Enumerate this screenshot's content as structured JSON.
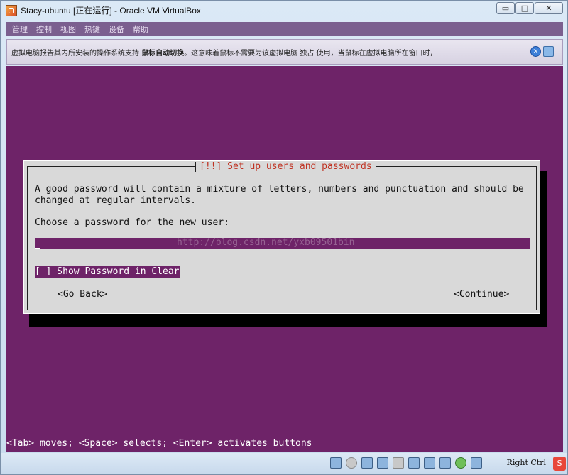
{
  "window": {
    "title": "Stacy-ubuntu [正在运行] - Oracle VM VirtualBox",
    "controls": {
      "minimize": "▭",
      "maximize": "□",
      "close": "✕"
    }
  },
  "menu": {
    "items": [
      {
        "label": "管理"
      },
      {
        "label": "控制"
      },
      {
        "label": "视图"
      },
      {
        "label": "热键"
      },
      {
        "label": "设备"
      },
      {
        "label": "帮助"
      }
    ]
  },
  "infobar": {
    "text_before": "虚拟电脑报告其内所安装的操作系统支持 ",
    "bold": "鼠标自动切换",
    "text_after": "。这意味着鼠标不需要为该虚拟电脑 独占 使用，当鼠标在虚拟电脑所在窗口时，"
  },
  "dialog": {
    "title": "[!!] Set up users and passwords",
    "description": "A good password will contain a mixture of letters, numbers and punctuation and should be\nchanged at regular intervals.",
    "prompt": "Choose a password for the new user:",
    "password_value": "",
    "watermark": "http://blog.csdn.net/yxb09501bin",
    "checkbox_label": "[ ] Show Password in Clear",
    "back_button": "<Go Back>",
    "continue_button": "<Continue>"
  },
  "screen": {
    "status_line": "<Tab> moves; <Space> selects; <Enter> activates buttons"
  },
  "statusbar": {
    "host_key": "Right Ctrl",
    "badge": "S"
  },
  "colors": {
    "guest_background": "#6e2368",
    "dialog_background": "#d9d9d9",
    "dialog_title": "#c03222"
  }
}
